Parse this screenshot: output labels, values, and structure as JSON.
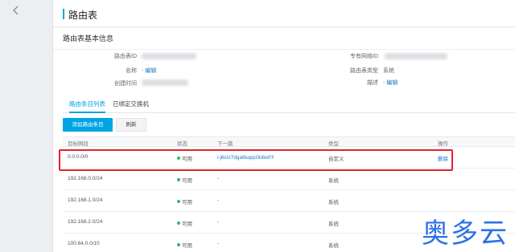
{
  "header": {
    "title": "路由表"
  },
  "basic": {
    "section_title": "路由表基本信息",
    "route_table_id_label": "路由表ID",
    "name_label": "名称",
    "name_value": "-",
    "edit_label": "编辑",
    "created_label": "创建时间",
    "vpc_id_label": "专有网络ID",
    "type_label": "路由表类型",
    "type_value": "系统",
    "desc_label": "描述",
    "desc_value": "-"
  },
  "tabs": {
    "entries": "路由条目列表",
    "bound_switches": "已绑定交换机"
  },
  "toolbar": {
    "add": "添加路由条目",
    "refresh": "刷新"
  },
  "table": {
    "headers": {
      "dest": "目标网段",
      "status": "状态",
      "next_hop": "下一跳",
      "type": "类型",
      "action": "操作"
    },
    "rows": [
      {
        "dest": "0.0.0.0/0",
        "status": "可用",
        "next_hop": "i-j6ciz7dga6iupp2lobwf①",
        "type": "自定义",
        "action": "删除"
      },
      {
        "dest": "192.168.0.0/24",
        "status": "可用",
        "next_hop": "-",
        "type": "系统",
        "action": ""
      },
      {
        "dest": "192.168.1.0/24",
        "status": "可用",
        "next_hop": "-",
        "type": "系统",
        "action": ""
      },
      {
        "dest": "192.168.2.0/24",
        "status": "可用",
        "next_hop": "-",
        "type": "系统",
        "action": ""
      },
      {
        "dest": "100.64.0.0/10",
        "status": "可用",
        "next_hop": "-",
        "type": "系统",
        "action": ""
      }
    ]
  },
  "watermark": "奥多云",
  "colors": {
    "accent": "#00a4e4",
    "status_ok": "#2dbd62",
    "highlight": "#e0262f",
    "link": "#1a74c9",
    "watermark": "#2c72e6"
  },
  "icons": {
    "back": "chevron-left-icon"
  }
}
